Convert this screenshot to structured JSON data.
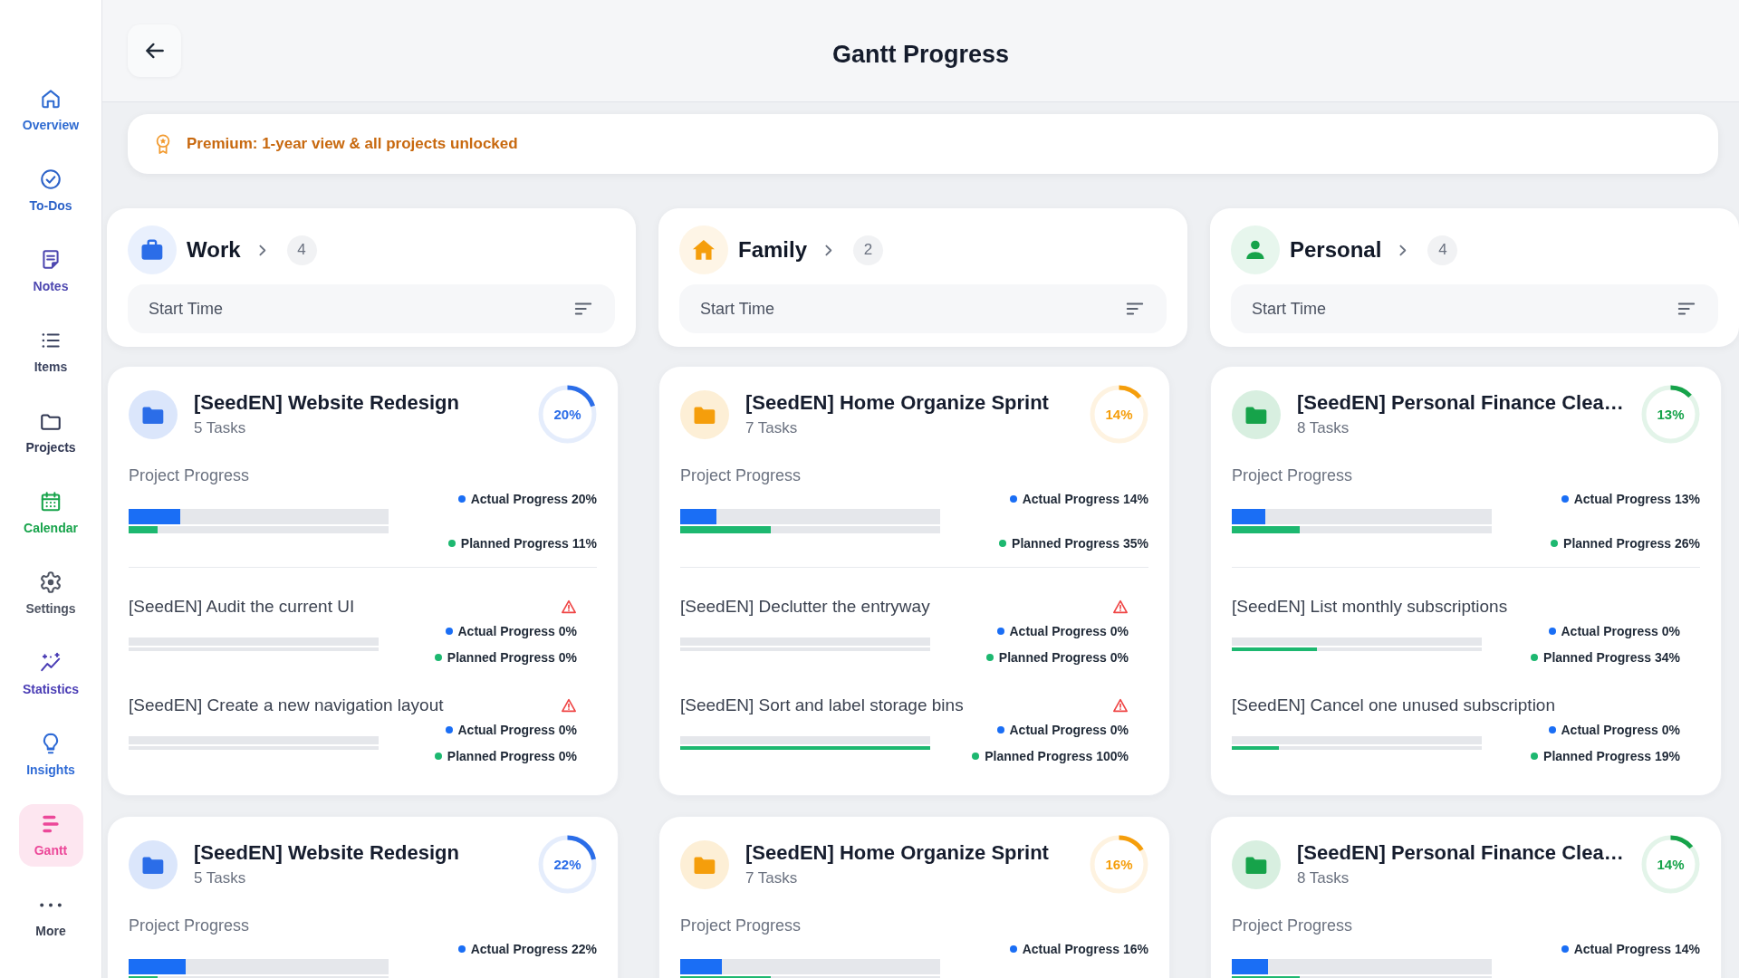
{
  "sidebar": {
    "items": [
      {
        "label": "Overview",
        "color": "#2f6bd1",
        "selected": false
      },
      {
        "label": "To-Dos",
        "color": "#2c62c8",
        "selected": false
      },
      {
        "label": "Notes",
        "color": "#4d47b0",
        "selected": false
      },
      {
        "label": "Items",
        "color": "#3c4460",
        "selected": false
      },
      {
        "label": "Projects",
        "color": "#303752",
        "selected": false
      },
      {
        "label": "Calendar",
        "color": "#16a34a",
        "selected": false
      },
      {
        "label": "Settings",
        "color": "#4f5563",
        "selected": false
      },
      {
        "label": "Statistics",
        "color": "#4a3db5",
        "selected": false
      },
      {
        "label": "Insights",
        "color": "#2f6bd6",
        "selected": false
      },
      {
        "label": "Gantt",
        "color": "#ec4899",
        "selected": true
      },
      {
        "label": "More",
        "color": "#3a4152",
        "selected": false
      }
    ]
  },
  "header": {
    "title": "Gantt Progress"
  },
  "banner": {
    "text": "Premium: 1-year view & all projects unlocked"
  },
  "groups": [
    {
      "name": "Work",
      "count": "4",
      "color": "#2b6de8",
      "sort": {
        "value": "Start Time"
      },
      "projects": [
        {
          "title": "[SeedEN] Website Redesign",
          "task_count": "5 Tasks",
          "ring": {
            "text": "20%",
            "level": 0.2
          },
          "section_label": "Project Progress",
          "actual": {
            "label": "Actual Progress 20%",
            "level": 0.2
          },
          "planned": {
            "label": "Planned Progress 11%",
            "level": 0.11
          },
          "tasks": [
            {
              "title": "[SeedEN] Audit the current UI",
              "warning": true,
              "actual": {
                "label": "Actual Progress 0%",
                "level": 0
              },
              "planned": {
                "label": "Planned Progress 0%",
                "level": 0
              }
            },
            {
              "title": "[SeedEN] Create a new navigation layout",
              "warning": true,
              "actual": {
                "label": "Actual Progress 0%",
                "level": 0
              },
              "planned": {
                "label": "Planned Progress 0%",
                "level": 0
              }
            }
          ]
        },
        {
          "title": "[SeedEN] Website Redesign",
          "task_count": "5 Tasks",
          "ring": {
            "text": "22%",
            "level": 0.22
          },
          "section_label": "Project Progress",
          "actual": {
            "label": "Actual Progress 22%",
            "level": 0.22
          },
          "planned": {
            "level": 0.11
          }
        }
      ]
    },
    {
      "name": "Family",
      "count": "2",
      "color": "#f59e0b",
      "sort": {
        "value": "Start Time"
      },
      "projects": [
        {
          "title": "[SeedEN] Home Organize Sprint",
          "task_count": "7 Tasks",
          "ring": {
            "text": "14%",
            "level": 0.14
          },
          "section_label": "Project Progress",
          "actual": {
            "label": "Actual Progress 14%",
            "level": 0.14
          },
          "planned": {
            "label": "Planned Progress 35%",
            "level": 0.35
          },
          "tasks": [
            {
              "title": "[SeedEN] Declutter the entryway",
              "warning": true,
              "actual": {
                "label": "Actual Progress 0%",
                "level": 0
              },
              "planned": {
                "label": "Planned Progress 0%",
                "level": 0
              }
            },
            {
              "title": "[SeedEN] Sort and label storage bins",
              "warning": true,
              "actual": {
                "label": "Actual Progress 0%",
                "level": 0
              },
              "planned": {
                "label": "Planned Progress 100%",
                "level": 1
              }
            }
          ]
        },
        {
          "title": "[SeedEN] Home Organize Sprint",
          "task_count": "7 Tasks",
          "ring": {
            "text": "16%",
            "level": 0.16
          },
          "section_label": "Project Progress",
          "actual": {
            "label": "Actual Progress 16%",
            "level": 0.16
          },
          "planned": {
            "level": 0.35
          }
        }
      ]
    },
    {
      "name": "Personal",
      "count": "4",
      "color": "#16a34a",
      "sort": {
        "value": "Start Time"
      },
      "projects": [
        {
          "title": "[SeedEN] Personal Finance Clea…",
          "task_count": "8 Tasks",
          "ring": {
            "text": "13%",
            "level": 0.13
          },
          "section_label": "Project Progress",
          "actual": {
            "label": "Actual Progress 13%",
            "level": 0.13
          },
          "planned": {
            "label": "Planned Progress 26%",
            "level": 0.26
          },
          "tasks": [
            {
              "title": "[SeedEN] List monthly subscriptions",
              "warning": false,
              "actual": {
                "label": "Actual Progress 0%",
                "level": 0
              },
              "planned": {
                "label": "Planned Progress 34%",
                "level": 0.34
              }
            },
            {
              "title": "[SeedEN] Cancel one unused subscription",
              "warning": false,
              "actual": {
                "label": "Actual Progress 0%",
                "level": 0
              },
              "planned": {
                "label": "Planned Progress 19%",
                "level": 0.19
              }
            }
          ]
        },
        {
          "title": "[SeedEN] Personal Finance Clea…",
          "task_count": "8 Tasks",
          "ring": {
            "text": "14%",
            "level": 0.14
          },
          "section_label": "Project Progress",
          "actual": {
            "label": "Actual Progress 14%",
            "level": 0.14
          },
          "planned": {
            "level": 0.26
          }
        }
      ]
    }
  ]
}
